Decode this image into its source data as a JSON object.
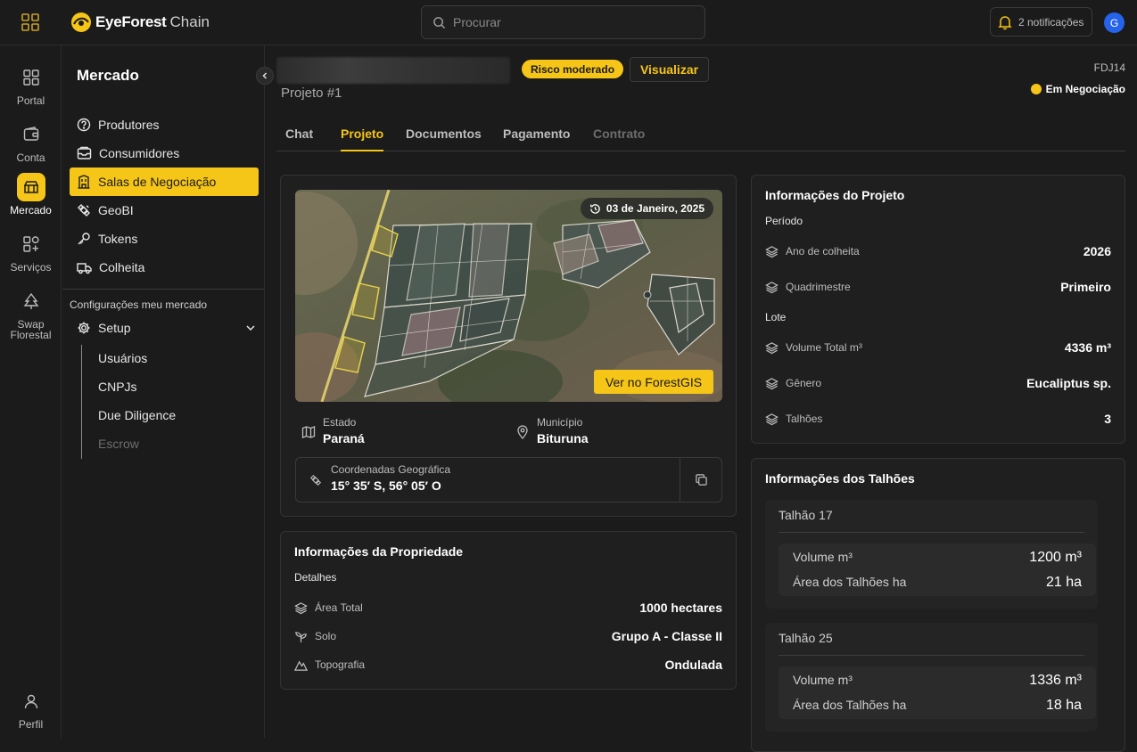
{
  "app": {
    "brand_bold": "EyeForest",
    "brand_light": "Chain"
  },
  "search": {
    "placeholder": "Procurar"
  },
  "notifications": {
    "label": "2 notificações"
  },
  "user": {
    "initial": "G"
  },
  "rail": [
    {
      "label": "Portal",
      "icon": "grid-icon"
    },
    {
      "label": "Conta",
      "icon": "wallet-icon"
    },
    {
      "label": "Mercado",
      "icon": "market-icon",
      "active": true
    },
    {
      "label": "Serviços",
      "icon": "services-icon"
    },
    {
      "label": "Swap Florestal",
      "icon": "tree-icon"
    },
    {
      "label": "Perfil",
      "icon": "user-icon"
    }
  ],
  "sidebar": {
    "title": "Mercado",
    "items": [
      {
        "label": "Produtores",
        "icon": "help-circle-icon"
      },
      {
        "label": "Consumidores",
        "icon": "inbox-icon"
      },
      {
        "label": "Salas de Negociação",
        "icon": "building-icon",
        "active": true
      },
      {
        "label": "GeoBI",
        "icon": "satellite-icon"
      },
      {
        "label": "Tokens",
        "icon": "key-icon"
      },
      {
        "label": "Colheita",
        "icon": "truck-icon"
      }
    ],
    "config_label": "Configurações meu mercado",
    "setup_label": "Setup",
    "sub_items": [
      {
        "label": "Usuários"
      },
      {
        "label": "CNPJs"
      },
      {
        "label": "Due Diligence"
      },
      {
        "label": "Escrow",
        "disabled": true
      }
    ]
  },
  "project": {
    "risk": "Risco moderado",
    "view_button": "Visualizar",
    "name": "Projeto #1",
    "code": "FDJ14",
    "status": "Em Negociação",
    "status_color": "#f5c518"
  },
  "tabs": [
    {
      "label": "Chat"
    },
    {
      "label": "Projeto",
      "active": true
    },
    {
      "label": "Documentos"
    },
    {
      "label": "Pagamento"
    },
    {
      "label": "Contrato",
      "disabled": true
    }
  ],
  "map": {
    "date": "03 de Janeiro, 2025",
    "gis_button": "Ver no ForestGIS"
  },
  "location": {
    "estado_label": "Estado",
    "estado": "Paraná",
    "municipio_label": "Município",
    "municipio": "Bituruna",
    "coord_label": "Coordenadas Geográfica",
    "coord": "15° 35′ S, 56° 05′ O"
  },
  "property": {
    "title": "Informações da Propriedade",
    "section": "Detalhes",
    "rows": [
      {
        "label": "Área Total",
        "value": "1000 hectares",
        "icon": "layers-icon"
      },
      {
        "label": "Solo",
        "value": "Grupo A - Classe II",
        "icon": "sprout-icon"
      },
      {
        "label": "Topografia",
        "value": "Ondulada",
        "icon": "mountain-icon"
      }
    ]
  },
  "project_info": {
    "title": "Informações do Projeto",
    "period_label": "Período",
    "period_rows": [
      {
        "label": "Ano de colheita",
        "value": "2026"
      },
      {
        "label": "Quadrimestre",
        "value": "Primeiro"
      }
    ],
    "lot_label": "Lote",
    "lot_rows": [
      {
        "label": "Volume Total m³",
        "value": "4336 m³"
      },
      {
        "label": "Gênero",
        "value": "Eucaliptus sp."
      },
      {
        "label": "Talhões",
        "value": "3"
      }
    ]
  },
  "talhoes": {
    "title": "Informações dos Talhões",
    "items": [
      {
        "name": "Talhão 17",
        "volume_label": "Volume  m³",
        "volume": "1200 m³",
        "area_label": "Área dos Talhões  ha",
        "area": "21 ha"
      },
      {
        "name": "Talhão 25",
        "volume_label": "Volume  m³",
        "volume": "1336 m³",
        "area_label": "Área dos Talhões  ha",
        "area": "18 ha"
      }
    ]
  },
  "colors": {
    "accent": "#f5c518",
    "background": "#1b1b1b",
    "avatar": "#2563eb"
  }
}
